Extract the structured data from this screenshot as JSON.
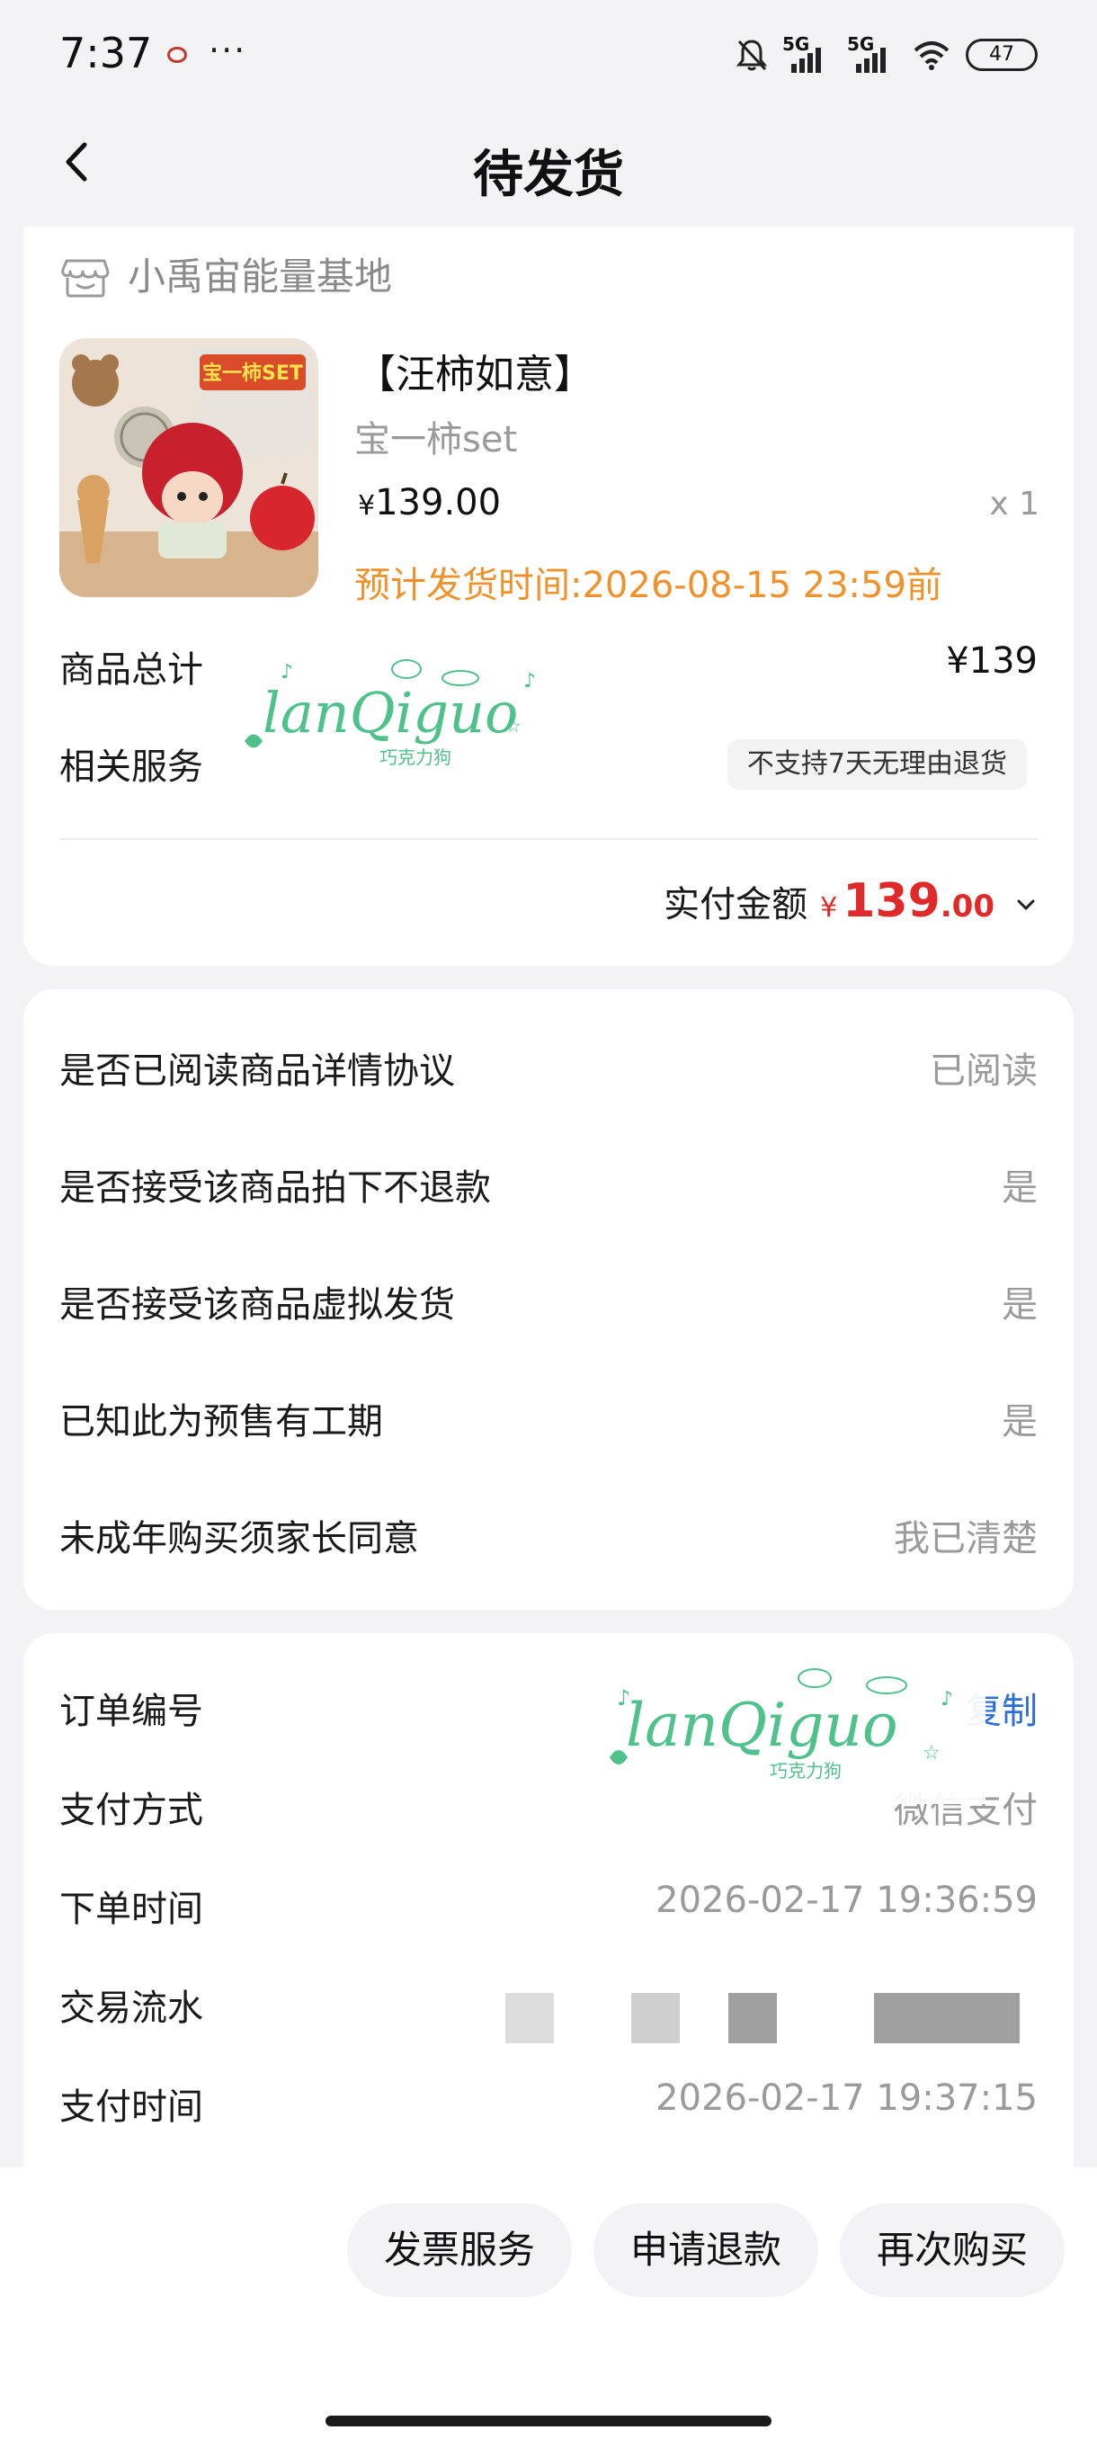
{
  "status_bar": {
    "time": "7:37",
    "dots": "···",
    "network_a": "5G",
    "network_b": "5G",
    "battery": "47"
  },
  "header": {
    "title": "待发货"
  },
  "shop": {
    "name": "小禹宙能量基地"
  },
  "product": {
    "title": "【汪柿如意】",
    "sku": "宝一柿set",
    "price_symbol": "¥",
    "price": "139.00",
    "quantity": "x 1",
    "ship_time": "预计发货时间:2026-08-15 23:59前",
    "image_banner": "宝一柿SET"
  },
  "summary": {
    "total_label": "商品总计",
    "total_value": "¥139",
    "service_label": "相关服务",
    "service_value": "不支持7天无理由退货",
    "paid_label": "实付金额",
    "paid_currency": "¥",
    "paid_integer": "139",
    "paid_decimal": ".00"
  },
  "agreements": [
    {
      "label": "是否已阅读商品详情协议",
      "value": "已阅读"
    },
    {
      "label": "是否接受该商品拍下不退款",
      "value": "是"
    },
    {
      "label": "是否接受该商品虚拟发货",
      "value": "是"
    },
    {
      "label": "已知此为预售有工期",
      "value": "是"
    },
    {
      "label": "未成年购买须家长同意",
      "value": "我已清楚"
    }
  ],
  "order_info": {
    "order_no_label": "订单编号",
    "copy_label": "复制",
    "payment_label": "支付方式",
    "payment_value": "微信支付",
    "order_time_label": "下单时间",
    "order_time_value": "2026-02-17 19:36:59",
    "transaction_label": "交易流水",
    "pay_time_label": "支付时间",
    "pay_time_value": "2026-02-17 19:37:15"
  },
  "watermark": {
    "text": "lanQiguo",
    "subtext": "巧克力狗"
  },
  "actions": {
    "invoice": "发票服务",
    "refund": "申请退款",
    "rebuy": "再次购买"
  },
  "colors": {
    "accent_orange": "#f0922b",
    "price_red": "#e02a2a",
    "link_blue": "#2d6fd6",
    "watermark_green": "#4fc18b"
  }
}
